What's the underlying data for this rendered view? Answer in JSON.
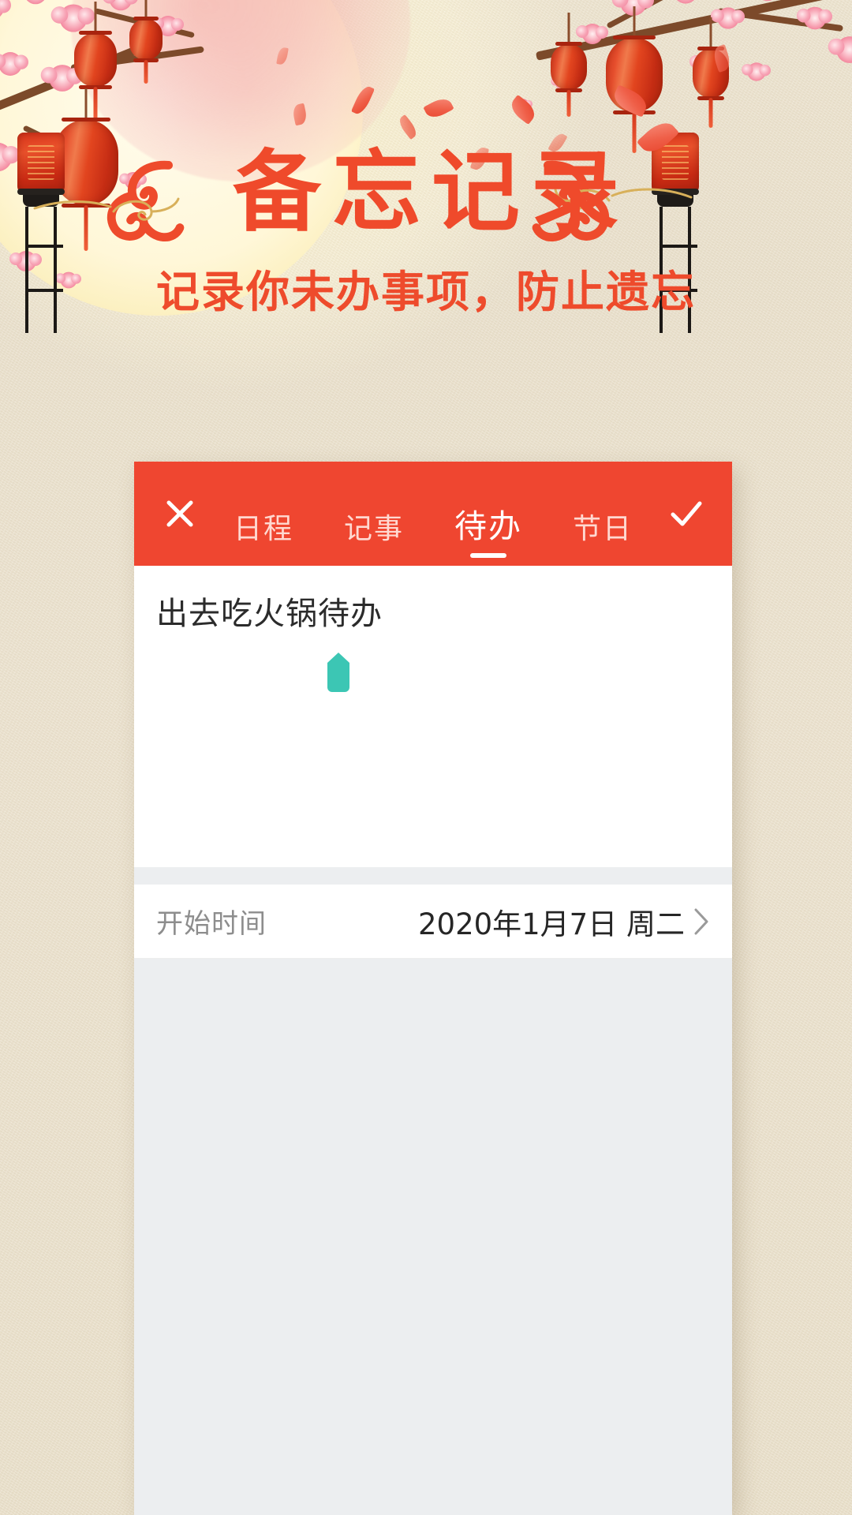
{
  "hero": {
    "title": "备忘记录",
    "subtitle": "记录你未办事项，防止遗忘",
    "title_color": "#ef4a2b",
    "subtitle_color": "#ee4b2c"
  },
  "app": {
    "accent_color": "#ef4630",
    "tabbar": {
      "close_icon": "close-icon",
      "confirm_icon": "check-icon",
      "tabs": [
        {
          "label": "日程",
          "active": false
        },
        {
          "label": "记事",
          "active": false
        },
        {
          "label": "待办",
          "active": true
        },
        {
          "label": "节日",
          "active": false
        }
      ]
    },
    "editor": {
      "value": "出去吃火锅待办",
      "placeholder": "",
      "caret_handle_color": "#3cc6b4"
    },
    "fields": [
      {
        "label": "开始时间",
        "value": "2020年1月7日 周二",
        "chevron": "chevron-right-icon"
      }
    ]
  },
  "decor": {
    "lantern_color": "#e2451f",
    "blossom_color": "#f4899f",
    "petal_color": "#ef5f48",
    "ruyi_color": "#ee4b2c"
  }
}
